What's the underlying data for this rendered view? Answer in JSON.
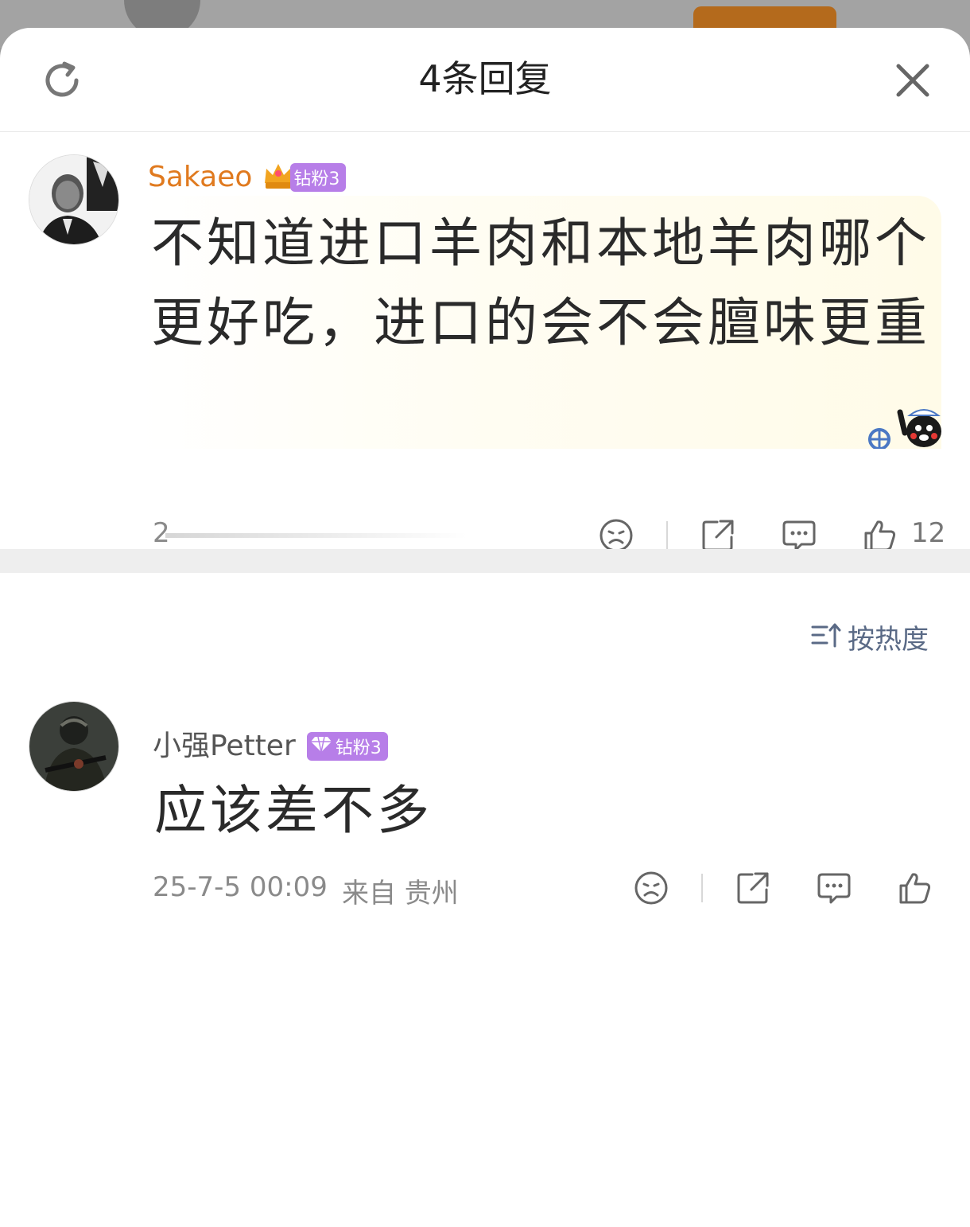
{
  "background": {
    "header_color": "#a3a3a3",
    "button_color": "#b46a1c"
  },
  "sheet": {
    "title": "4条回复",
    "refresh_icon": "refresh-icon",
    "close_icon": "close-icon"
  },
  "root_comment": {
    "username": "Sakaeo",
    "username_color": "#e07a1f",
    "badge_label": "钻粉3",
    "badge_icon": "crown-icon",
    "text": "不知道进口羊肉和本地羊肉哪个更好吃，进口的会不会膻味更重",
    "meta": "2",
    "like_count": "12",
    "decor_icon": "kumamon-sticker-icon"
  },
  "sort": {
    "label": "按热度",
    "icon": "sort-icon"
  },
  "reply": {
    "username": "小强Petter",
    "badge_label": "钻粉3",
    "badge_icon": "diamond-icon",
    "text": "应该差不多",
    "timestamp": "25-7-5 00:09",
    "location": "来自 贵州"
  },
  "actions": {
    "dislike_icon": "sad-face-icon",
    "share_icon": "share-icon",
    "comment_icon": "comment-icon",
    "like_icon": "thumbs-up-icon"
  }
}
